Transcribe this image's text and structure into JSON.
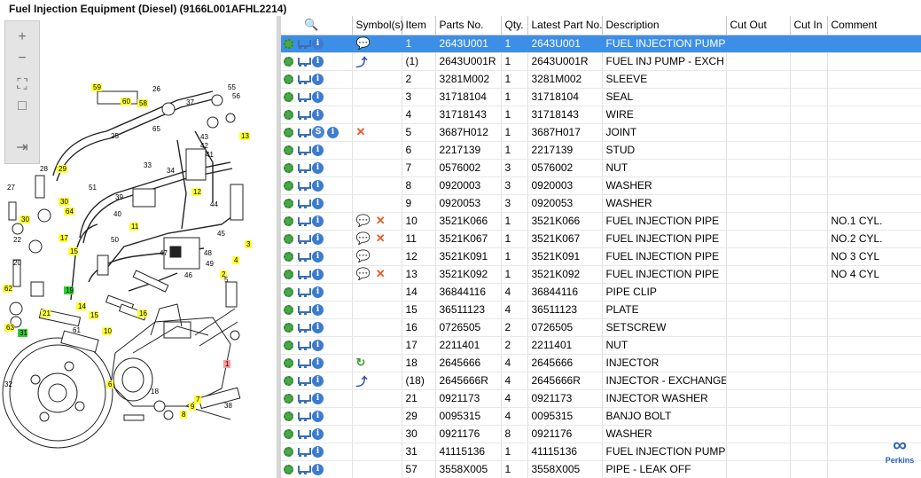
{
  "title": "Fuel Injection Equipment (Diesel) (9166L001AFHL2214)",
  "toolbar": {
    "buttons": [
      {
        "name": "zoom-in-icon",
        "glyph": "+"
      },
      {
        "name": "zoom-out-icon",
        "glyph": "−"
      },
      {
        "name": "fit-page-icon",
        "glyph": "⛶"
      },
      {
        "name": "actual-size-icon",
        "glyph": "□"
      },
      {
        "name": "expand-panel-icon",
        "glyph": "⇥"
      }
    ]
  },
  "grid": {
    "columns": [
      "",
      "Symbol(s)",
      "Item",
      "Parts No.",
      "Qty.",
      "Latest Part No.",
      "Description",
      "Cut Out",
      "Cut In",
      "Comment"
    ],
    "rows": [
      {
        "item": "1",
        "part": "2643U001",
        "qty": "1",
        "latest": "2643U001",
        "desc": "FUEL INJECTION PUMP",
        "comment": "",
        "sym": [
          "note"
        ],
        "sel": true
      },
      {
        "item": "(1)",
        "part": "2643U001R",
        "qty": "1",
        "latest": "2643U001R",
        "desc": "FUEL INJ PUMP - EXCH",
        "comment": "",
        "sym": [
          "exch"
        ]
      },
      {
        "item": "2",
        "part": "3281M002",
        "qty": "1",
        "latest": "3281M002",
        "desc": "SLEEVE",
        "comment": "",
        "sym": []
      },
      {
        "item": "3",
        "part": "31718104",
        "qty": "1",
        "latest": "31718104",
        "desc": "SEAL",
        "comment": "",
        "sym": []
      },
      {
        "item": "4",
        "part": "31718143",
        "qty": "1",
        "latest": "31718143",
        "desc": "WIRE",
        "comment": "",
        "sym": []
      },
      {
        "item": "5",
        "part": "3687H012",
        "qty": "1",
        "latest": "3687H017",
        "desc": "JOINT",
        "comment": "",
        "sym": [
          "x"
        ],
        "s": true
      },
      {
        "item": "6",
        "part": "2217139",
        "qty": "1",
        "latest": "2217139",
        "desc": "STUD",
        "comment": "",
        "sym": []
      },
      {
        "item": "7",
        "part": "0576002",
        "qty": "3",
        "latest": "0576002",
        "desc": "NUT",
        "comment": "",
        "sym": []
      },
      {
        "item": "8",
        "part": "0920003",
        "qty": "3",
        "latest": "0920003",
        "desc": "WASHER",
        "comment": "",
        "sym": []
      },
      {
        "item": "9",
        "part": "0920053",
        "qty": "3",
        "latest": "0920053",
        "desc": "WASHER",
        "comment": "",
        "sym": []
      },
      {
        "item": "10",
        "part": "3521K066",
        "qty": "1",
        "latest": "3521K066",
        "desc": "FUEL INJECTION PIPE",
        "comment": "NO.1 CYL.",
        "sym": [
          "note",
          "x"
        ]
      },
      {
        "item": "11",
        "part": "3521K067",
        "qty": "1",
        "latest": "3521K067",
        "desc": "FUEL INJECTION PIPE",
        "comment": "NO.2 CYL.",
        "sym": [
          "note",
          "x"
        ]
      },
      {
        "item": "12",
        "part": "3521K091",
        "qty": "1",
        "latest": "3521K091",
        "desc": "FUEL INJECTION PIPE",
        "comment": "NO 3 CYL",
        "sym": [
          "note"
        ]
      },
      {
        "item": "13",
        "part": "3521K092",
        "qty": "1",
        "latest": "3521K092",
        "desc": "FUEL INJECTION PIPE",
        "comment": "NO 4 CYL",
        "sym": [
          "note",
          "x"
        ]
      },
      {
        "item": "14",
        "part": "36844116",
        "qty": "4",
        "latest": "36844116",
        "desc": "PIPE CLIP",
        "comment": "",
        "sym": []
      },
      {
        "item": "15",
        "part": "36511123",
        "qty": "4",
        "latest": "36511123",
        "desc": "PLATE",
        "comment": "",
        "sym": []
      },
      {
        "item": "16",
        "part": "0726505",
        "qty": "2",
        "latest": "0726505",
        "desc": "SETSCREW",
        "comment": "",
        "sym": []
      },
      {
        "item": "17",
        "part": "2211401",
        "qty": "2",
        "latest": "2211401",
        "desc": "NUT",
        "comment": "",
        "sym": []
      },
      {
        "item": "18",
        "part": "2645666",
        "qty": "4",
        "latest": "2645666",
        "desc": "INJECTOR",
        "comment": "",
        "sym": [
          "green"
        ],
        "multi": true
      },
      {
        "item": "(18)",
        "part": "2645666R",
        "qty": "4",
        "latest": "2645666R",
        "desc": "INJECTOR - EXCHANGE",
        "comment": "",
        "sym": [
          "exch"
        ]
      },
      {
        "item": "21",
        "part": "0921173",
        "qty": "4",
        "latest": "0921173",
        "desc": "INJECTOR WASHER",
        "comment": "",
        "sym": []
      },
      {
        "item": "29",
        "part": "0095315",
        "qty": "4",
        "latest": "0095315",
        "desc": "BANJO BOLT",
        "comment": "",
        "sym": []
      },
      {
        "item": "30",
        "part": "0921176",
        "qty": "8",
        "latest": "0921176",
        "desc": "WASHER",
        "comment": "",
        "sym": []
      },
      {
        "item": "31",
        "part": "41115136",
        "qty": "1",
        "latest": "41115136",
        "desc": "FUEL INJECTION PUMP GEAR",
        "comment": "",
        "sym": [],
        "multi": true
      },
      {
        "item": "57",
        "part": "3558X005",
        "qty": "1",
        "latest": "3558X005",
        "desc": "PIPE - LEAK OFF",
        "comment": "",
        "sym": []
      }
    ]
  },
  "diagram": {
    "labels_yellow": [
      "59",
      "60",
      "58",
      "13",
      "29",
      "30",
      "64",
      "30",
      "17",
      "11",
      "12",
      "15",
      "14",
      "16",
      "15",
      "10",
      "21",
      "62",
      "3",
      "4",
      "2",
      "6",
      "7",
      "8",
      "9"
    ],
    "labels_green": [
      "19",
      "31"
    ],
    "labels_red": [
      "1"
    ],
    "labels_plain": [
      "26",
      "37",
      "55",
      "56",
      "65",
      "25",
      "43",
      "42",
      "41",
      "51",
      "39",
      "40",
      "33",
      "34",
      "27",
      "28",
      "44",
      "45",
      "47",
      "48",
      "49",
      "46",
      "50",
      "63",
      "61",
      "32",
      "5",
      "38",
      "18",
      "20",
      "22"
    ]
  },
  "logo": {
    "text": "Perkins",
    "mark": "∞"
  }
}
